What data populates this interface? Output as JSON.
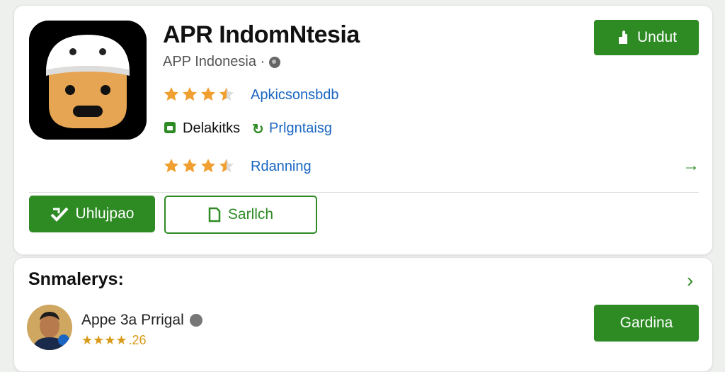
{
  "app": {
    "title": "APR IndomNtesia",
    "developer": "APP Indonesia ·",
    "install_label": "Undut",
    "rating_stars": 3.5,
    "row1_link": "Apkicsonsbdb",
    "row2_text": "Delakitks",
    "row2_link": "Prlgntaisg",
    "rating_stars_2": 3.5,
    "row3_link": "Rdanning"
  },
  "actions": {
    "primary_label": "Uhlujpao",
    "secondary_label": "Sarllch"
  },
  "reviews": {
    "section_title": "Snmalerys:",
    "item": {
      "name": "Appe 3a Prrigal",
      "stars_text": "★★★★",
      "rating_text": ".26",
      "install_label": "Gardina"
    }
  },
  "colors": {
    "accent": "#2e8b24",
    "link": "#1a66c2",
    "star": "#f0a030"
  }
}
